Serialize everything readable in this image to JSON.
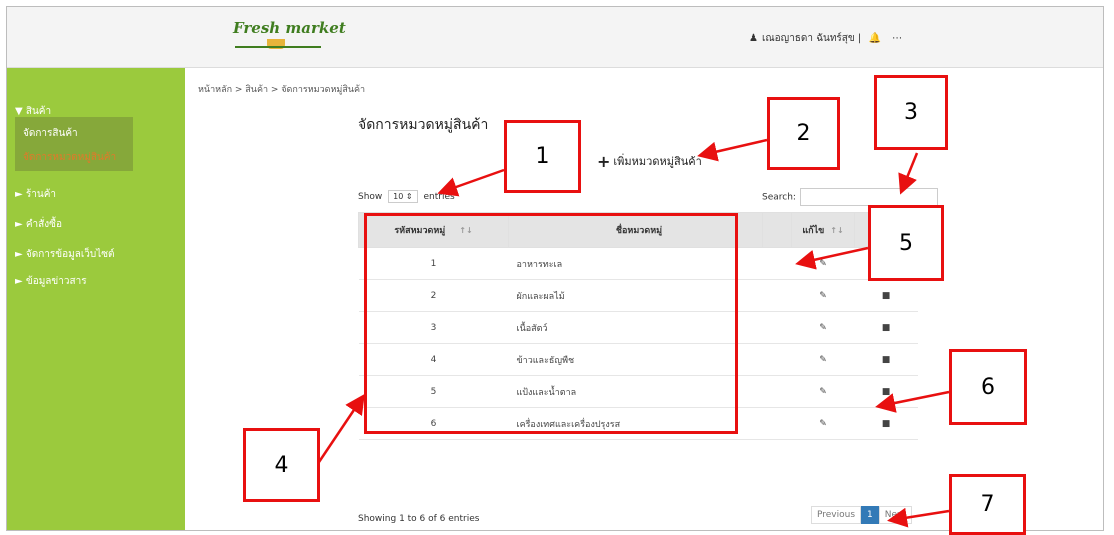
{
  "header": {
    "logo_text": "Fresh market",
    "user": "เณอญาธดา ฉันทร์สุข |",
    "bell_icon": "bell-icon",
    "more_icon": "ellipsis-icon",
    "user_icon": "user-icon"
  },
  "sidebar": {
    "items": [
      {
        "label": "▼ สินค้า"
      },
      {
        "label": "► ร้านค้า"
      },
      {
        "label": "► คำสั่งซื้อ"
      },
      {
        "label": "► จัดการข้อมูลเว็บไซต์"
      },
      {
        "label": "► ข้อมูลข่าวสาร"
      }
    ],
    "sub": [
      {
        "label": "จัดการสินค้า"
      },
      {
        "label": "จัดการหมวดหมู่สินค้า"
      }
    ],
    "active_color": "#e07a2a"
  },
  "breadcrumb": "หน้าหลัก > สินค้า > จัดการหมวดหมู่สินค้า",
  "page_title": "จัดการหมวดหมู่สินค้า",
  "add_button": "เพิ่มหมวดหมู่สินค้า",
  "length_menu": {
    "prefix": "Show",
    "value": "10",
    "suffix": "entries"
  },
  "search": {
    "label": "Search:"
  },
  "table": {
    "headers": [
      "รหัสหมวดหมู่",
      "ชื่อหมวดหมู่",
      "แก้ไข",
      ""
    ],
    "rows": [
      {
        "id": "1",
        "name": "อาหารทะเล"
      },
      {
        "id": "2",
        "name": "ผักและผลไม้"
      },
      {
        "id": "3",
        "name": "เนื้อสัตว์"
      },
      {
        "id": "4",
        "name": "ข้าวและธัญพืช"
      },
      {
        "id": "5",
        "name": "แป้งและน้ำตาล"
      },
      {
        "id": "6",
        "name": "เครื่องเทศและเครื่องปรุงรส"
      }
    ]
  },
  "info": "Showing 1 to 6 of 6 entries",
  "pagination": {
    "previous": "Previous",
    "current": "1",
    "next": "Next"
  },
  "callouts": [
    "1",
    "2",
    "3",
    "4",
    "5",
    "6",
    "7"
  ],
  "colors": {
    "sidebar": "#9bca3d",
    "annotation": "#e81010",
    "pager_active": "#337ab7"
  }
}
